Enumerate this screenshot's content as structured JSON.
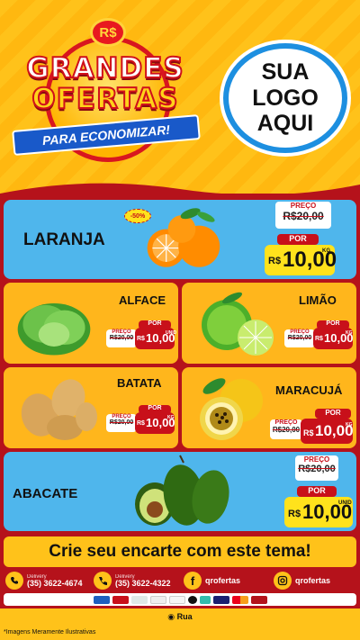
{
  "header": {
    "coin_symbol": "R$",
    "title_line1": "GRANDES",
    "title_line2": "OFERTAS",
    "ribbon": "PARA ECONOMIZAR!",
    "logo_line1": "SUA",
    "logo_line2": "LOGO",
    "logo_line3": "AQUI"
  },
  "products": [
    {
      "name": "LARANJA",
      "discount": "-50%",
      "preco_label": "PREÇO",
      "old_price": "R$20,00",
      "por_label": "POR",
      "currency": "R$",
      "price": "10,00",
      "unit": "KG"
    },
    {
      "name": "ALFACE",
      "preco_label": "PREÇO",
      "old_price": "R$20,00",
      "por_label": "POR",
      "currency": "R$",
      "price": "10,00",
      "unit": "UNID"
    },
    {
      "name": "LIMÃO",
      "preco_label": "PREÇO",
      "old_price": "R$20,00",
      "por_label": "POR",
      "currency": "R$",
      "price": "10,00",
      "unit": "KG"
    },
    {
      "name": "BATATA",
      "preco_label": "PREÇO",
      "old_price": "R$20,00",
      "por_label": "POR",
      "currency": "R$",
      "price": "10,00",
      "unit": "KG"
    },
    {
      "name": "MARACUJÁ",
      "preco_label": "PREÇO",
      "old_price": "R$20,00",
      "por_label": "POR",
      "currency": "R$",
      "price": "10,00",
      "unit": "KG"
    },
    {
      "name": "ABACATE",
      "preco_label": "PREÇO",
      "old_price": "R$20,00",
      "por_label": "POR",
      "currency": "R$",
      "price": "10,00",
      "unit": "UNID"
    }
  ],
  "cta": "Crie seu encarte com este tema!",
  "contacts": {
    "whatsapp_label": "Delivery",
    "whatsapp_number": "(35) 3622-4674",
    "phone_label": "Delivery",
    "phone_number": "(35) 3622-4322",
    "facebook": "qrofertas",
    "instagram": "qrofertas"
  },
  "payment_methods": [
    "card",
    "card",
    "pix",
    "card",
    "card",
    "elo",
    "pix",
    "visa",
    "mastercard",
    "hipercard"
  ],
  "address": "Rua",
  "disclaimer": "*Imagens Meramente Ilustrativas",
  "colors": {
    "brand_red": "#c8101a",
    "yellow": "#ffc21a",
    "blue_card": "#4fb6ec",
    "orange_card": "#ffb61c"
  }
}
